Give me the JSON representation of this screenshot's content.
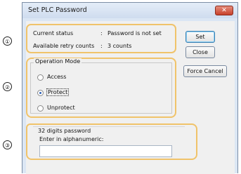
{
  "window": {
    "title": "Set PLC Password",
    "close_glyph": "✕"
  },
  "callouts": [
    "①",
    "②",
    "③"
  ],
  "status": {
    "current_label": "Current status",
    "current_sep": ":",
    "current_value": "Password is not set",
    "retry_label": "Available retry counts",
    "retry_sep": ":",
    "retry_value": "3 counts"
  },
  "operation_mode": {
    "label": "Operation Mode",
    "options": [
      "Access",
      "Protect",
      "Unprotect"
    ],
    "selected": "Protect"
  },
  "password": {
    "group_label": "32 digits password",
    "prompt": "Enter in alphanumeric:",
    "value": ""
  },
  "buttons": {
    "set": "Set",
    "close": "Close",
    "force_cancel": "Force Cancel"
  },
  "colors": {
    "highlight_outline": "#f0c36a",
    "close_button": "#c7402a",
    "dialog_frame": "#dbe6f4"
  }
}
